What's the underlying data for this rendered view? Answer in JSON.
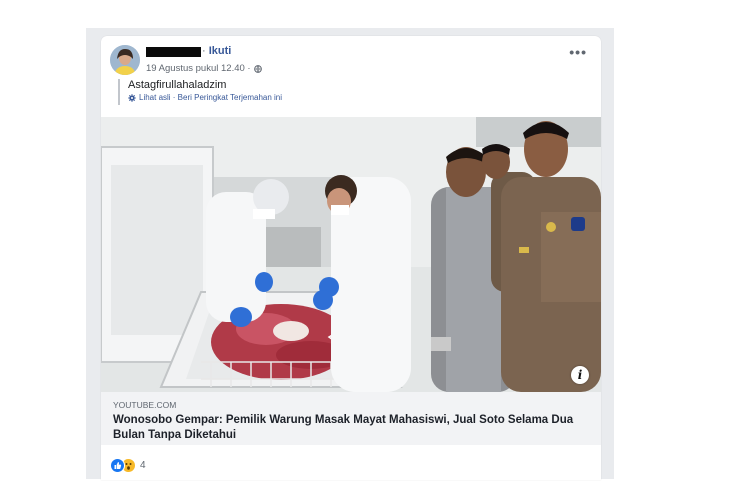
{
  "post": {
    "follow_label": "Ikuti",
    "separator": "·",
    "timestamp": "19 Agustus pukul 12.40 ·",
    "privacy_icon": "globe-icon",
    "more_label": "•••",
    "text": "Astagfirullahaladzim",
    "translation_links": "Lihat asli · Beri Peringkat Terjemahan ini"
  },
  "link_preview": {
    "domain": "YOUTUBE.COM",
    "headline": "Wonosobo Gempar: Pemilik Warung Masak Mayat Mahasiswi, Jual Soto Selama Dua Bulan Tanpa Diketahui",
    "info_label": "i"
  },
  "reactions": {
    "types": [
      "like",
      "wow"
    ],
    "count": "4"
  },
  "colors": {
    "link_blue": "#385898",
    "like_blue": "#1877f2",
    "wow_yellow": "#f7b928",
    "link_box_bg": "#f2f3f5"
  }
}
